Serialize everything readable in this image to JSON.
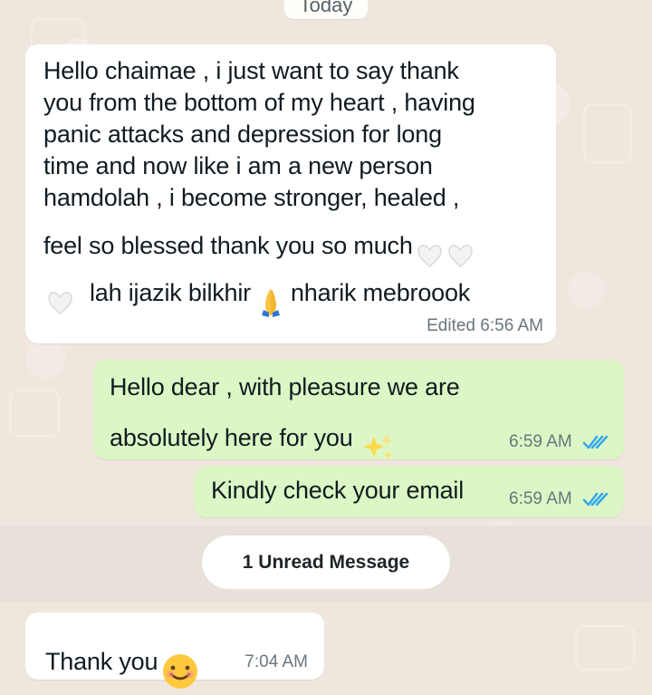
{
  "chat": {
    "date_separator": "Today",
    "unread_label": "1 Unread Message",
    "messages": [
      {
        "direction": "incoming",
        "line1": "Hello chaimae , i just want to say thank",
        "line2": "you from the bottom of my heart , having",
        "line3": "panic attacks and depression for long",
        "line4": "time and now like i am a new person",
        "line5": "hamdolah , i become stronger, healed ,",
        "line6": "feel so blessed thank you so much",
        "line7_part1": "lah ijazik bilkhir",
        "line7_part2": "nharik mebroook",
        "meta": "Edited 6:56 AM",
        "icons": [
          "white-heart-icon",
          "white-heart-icon",
          "white-heart-icon",
          "folded-hands-icon"
        ]
      },
      {
        "direction": "outgoing",
        "line1": "Hello dear , with pleasure  we are",
        "line2": "absolutely here for you",
        "time": "6:59 AM",
        "icons": [
          "sparkles-icon",
          "double-check-icon"
        ]
      },
      {
        "direction": "outgoing",
        "text": "Kindly check your email",
        "time": "6:59 AM",
        "icons": [
          "double-check-icon"
        ]
      },
      {
        "direction": "incoming",
        "text": "Thank you",
        "time": "7:04 AM",
        "icons": [
          "smiling-face-icon"
        ]
      }
    ]
  },
  "colors": {
    "background": "#efe7dd",
    "incoming_bubble": "#ffffff",
    "outgoing_bubble": "#dcf7c5",
    "text": "#111b21",
    "meta_text": "#69757d",
    "read_check": "#34a7f2"
  }
}
